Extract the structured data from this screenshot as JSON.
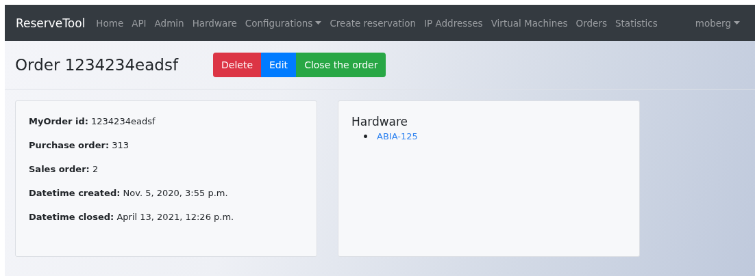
{
  "navbar": {
    "brand": "ReserveTool",
    "items": [
      {
        "label": "Home",
        "kind": "link"
      },
      {
        "label": "API",
        "kind": "link"
      },
      {
        "label": "Admin",
        "kind": "link"
      },
      {
        "label": "Hardware",
        "kind": "link"
      },
      {
        "label": "Configurations",
        "kind": "dropdown"
      },
      {
        "label": "Create reservation",
        "kind": "link"
      },
      {
        "label": "IP Addresses",
        "kind": "link"
      },
      {
        "label": "Virtual Machines",
        "kind": "link"
      },
      {
        "label": "Orders",
        "kind": "link"
      },
      {
        "label": "Statistics",
        "kind": "link"
      }
    ],
    "user": {
      "label": "moberg",
      "kind": "dropdown"
    }
  },
  "page": {
    "title": "Order 1234234eadsf",
    "buttons": [
      {
        "label": "Delete",
        "kind": "danger"
      },
      {
        "label": "Edit",
        "kind": "primary"
      },
      {
        "label": "Close the order",
        "kind": "success"
      }
    ]
  },
  "details": [
    {
      "label": "MyOrder id:",
      "value": "1234234eadsf"
    },
    {
      "label": "Purchase order:",
      "value": "313"
    },
    {
      "label": "Sales order:",
      "value": "2"
    },
    {
      "label": "Datetime created:",
      "value": "Nov. 5, 2020, 3:55 p.m."
    },
    {
      "label": "Datetime closed:",
      "value": "April 13, 2021, 12:26 p.m."
    }
  ],
  "hardware": {
    "title": "Hardware",
    "items": [
      "ABIA-125"
    ]
  }
}
